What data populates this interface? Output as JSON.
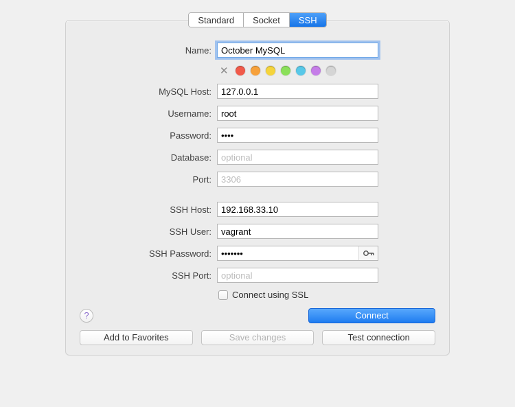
{
  "tabs": {
    "standard": "Standard",
    "socket": "Socket",
    "ssh": "SSH"
  },
  "labels": {
    "name": "Name:",
    "mysql_host": "MySQL Host:",
    "username": "Username:",
    "password": "Password:",
    "database": "Database:",
    "port": "Port:",
    "ssh_host": "SSH Host:",
    "ssh_user": "SSH User:",
    "ssh_password": "SSH Password:",
    "ssh_port": "SSH Port:",
    "ssl_checkbox": "Connect using SSL"
  },
  "values": {
    "name": "October MySQL",
    "mysql_host": "127.0.0.1",
    "username": "root",
    "password": "••••",
    "database": "",
    "port": "",
    "ssh_host": "192.168.33.10",
    "ssh_user": "vagrant",
    "ssh_password": "•••••••",
    "ssh_port": ""
  },
  "placeholders": {
    "database": "optional",
    "port": "3306",
    "ssh_port": "optional"
  },
  "buttons": {
    "connect": "Connect",
    "add_fav": "Add to Favorites",
    "save": "Save changes",
    "test": "Test connection",
    "help": "?"
  },
  "colors": [
    "#f15a4a",
    "#f7a13b",
    "#f5d43c",
    "#8be05a",
    "#58c8e8",
    "#c57de8",
    "#d5d5d5"
  ]
}
